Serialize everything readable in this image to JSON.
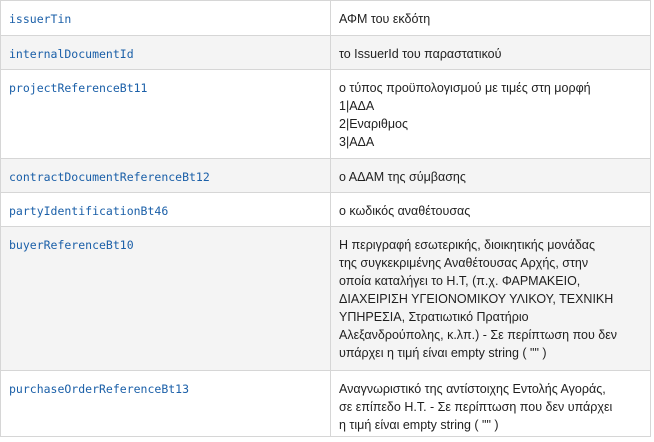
{
  "rows": [
    {
      "field": "issuerTin",
      "description": [
        "ΑΦΜ του εκδότη"
      ]
    },
    {
      "field": "internalDocumentId",
      "description": [
        "το IssuerId του παραστατικού"
      ]
    },
    {
      "field": "projectReferenceBt11",
      "description": [
        "ο τύπος προϋπολογισμού με τιμές στη μορφή",
        "1|ΑΔΑ",
        "2|Εναριθμος",
        "3|ΑΔΑ"
      ]
    },
    {
      "field": "contractDocumentReferenceBt12",
      "description": [
        "ο ΑΔΑΜ της σύμβασης"
      ]
    },
    {
      "field": "partyIdentificationBt46",
      "description": [
        "ο κωδικός αναθέτουσας"
      ]
    },
    {
      "field": "buyerReferenceBt10",
      "description": [
        "Η περιγραφή εσωτερικής, διοικητικής μονάδας",
        "της συγκεκριμένης Αναθέτουσας Αρχής, στην",
        "οποία καταλήγει το Η.Τ, (π.χ.  ΦΑΡΜΑΚΕΙΟ,",
        "ΔΙΑΧΕΙΡΙΣΗ ΥΓΕΙΟΝΟΜΙΚΟΥ ΥΛΙΚΟΥ, ΤΕΧΝΙΚΗ",
        "ΥΠΗΡΕΣΙΑ, Στρατιωτικό Πρατήριο",
        "Αλεξανδρούπολης, κ.λπ.) - Σε περίπτωση που δεν",
        "υπάρχει η τιμή είναι empty string ( \"\" )"
      ]
    },
    {
      "field": "purchaseOrderReferenceBt13",
      "description": [
        "Αναγνωριστικό της αντίστοιχης Εντολής Αγοράς,",
        "σε επίπεδο Η.Τ.  - Σε περίπτωση που δεν υπάρχει",
        "η τιμή είναι empty string ( \"\" )"
      ]
    }
  ]
}
